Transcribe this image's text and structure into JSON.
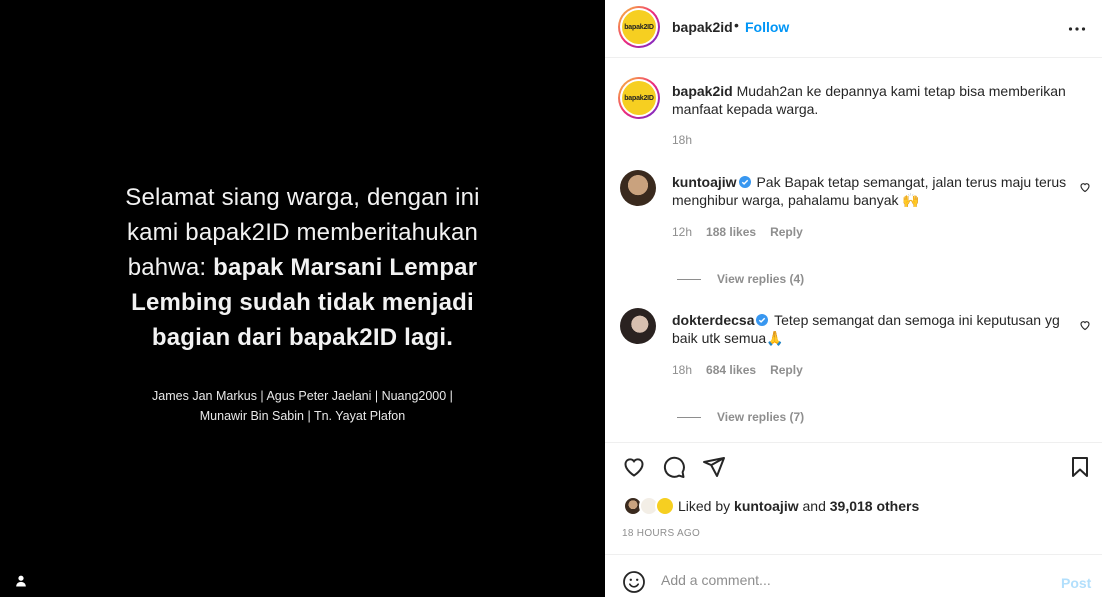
{
  "media": {
    "lines": [
      "Selamat siang warga, dengan ini",
      "kami bapak2ID memberitahukan"
    ],
    "line3_normal": "bahwa: ",
    "line3_bold": "bapak Marsani Lempar",
    "line4_bold": "Lembing sudah tidak menjadi",
    "line5_bold": "bagian dari bapak2ID lagi.",
    "names_line1": "James Jan Markus | Agus Peter Jaelani | Nuang2000 |",
    "names_line2": "Munawir Bin Sabin | Tn. Yayat Plafon"
  },
  "header": {
    "logo_text": "bapak2ID",
    "username": "bapak2id",
    "dot": "•",
    "follow": "Follow"
  },
  "caption": {
    "username": "bapak2id",
    "text": "Mudah2an ke depannya kami tetap bisa memberikan manfaat kepada warga.",
    "time": "18h"
  },
  "comments": [
    {
      "username": "kuntoajiw",
      "text": "Pak Bapak tetap semangat, jalan terus maju terus menghibur warga, pahalamu banyak 🙌",
      "time": "12h",
      "likes": "188 likes",
      "reply": "Reply",
      "view_replies": "View replies (4)"
    },
    {
      "username": "dokterdecsa",
      "text": "Tetep semangat dan semoga ini keputusan yg baik utk semua🙏",
      "time": "18h",
      "likes": "684 likes",
      "reply": "Reply",
      "view_replies": "View replies (7)"
    }
  ],
  "likes": {
    "prefix": "Liked by ",
    "user": "kuntoajiw",
    "middle": " and ",
    "others": "39,018 others"
  },
  "timestamp": "18 HOURS AGO",
  "add_comment": {
    "placeholder": "Add a comment...",
    "post": "Post"
  },
  "colors": {
    "follow": "#0095f6",
    "post_disabled": "#b2dffc",
    "verified": "#3897f0",
    "logo_yellow": "#f6cf21"
  }
}
